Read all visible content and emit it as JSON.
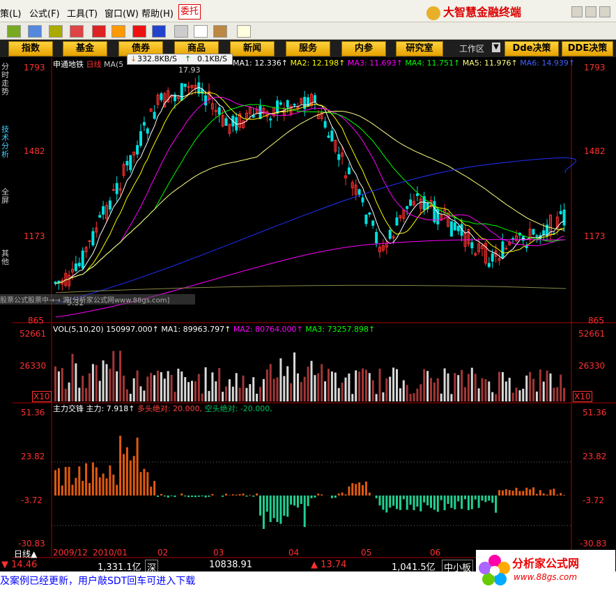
{
  "menu": {
    "items": [
      "策(L)",
      "公式(F)",
      "工具(T)",
      "窗口(W)",
      "帮助(H)"
    ],
    "entrust": "委托",
    "brand": "大智慧金融终端"
  },
  "nav": {
    "buttons": [
      "指数",
      "基金",
      "债券",
      "商品",
      "新闻",
      "服务",
      "内参",
      "研究室"
    ],
    "workspace": "工作区",
    "dde1": "Dde决策",
    "dde2": "DDE决策",
    "speed_down": "332.8KB/S",
    "speed_up": "0.1KB/S"
  },
  "sidebar": {
    "tabs": [
      "分时走势",
      "技术分析",
      "全屏",
      "其他"
    ]
  },
  "price_panel": {
    "title": "申通地铁",
    "period": "日线",
    "ma_prefix": "MA(5",
    "ma1": "MA1: 12.336↑",
    "ma2": "MA2: 12.198↑",
    "ma3": "MA3: 11.693↑",
    "ma4": "MA4: 11.751↑",
    "ma5": "MA5: 11.976↑",
    "ma6": "MA6: 14.939↑",
    "ylabels": [
      "1793",
      "1482",
      "1173",
      "865"
    ],
    "high_label": "17.93",
    "low_label": "9.32",
    "watermark": "股票公式股票中→→ 源[分析家公式网www.88gs.com]"
  },
  "vol_panel": {
    "title": "VOL(5,10,20)",
    "vol": "150997.000↑",
    "ma1": "MA1: 89963.797↑",
    "ma2": "MA2: 80764.000↑",
    "ma3": "MA3: 73257.898↑",
    "ylabels": [
      "52661",
      "26330",
      "X10"
    ]
  },
  "indicator_panel": {
    "title": "主力交锋",
    "main": "主力: 7.918↑",
    "bull": "多头绝对: 20.000,",
    "bear": "空头绝对: -20.000,",
    "ylabels": [
      "51.36",
      "23.82",
      "-3.72",
      "-30.83"
    ]
  },
  "dates": [
    "2009/12",
    "2010/01",
    "02",
    "03",
    "04",
    "05",
    "06"
  ],
  "status": {
    "day_button": "日线▲",
    "idx_change": "▼ 14.46",
    "amount": "1,331.1亿",
    "market": "深",
    "sz_index": "10838.91",
    "sz_change": "▲ 13.74",
    "sz_amount": "1,041.5亿",
    "board": "中小板"
  },
  "ticker": "及案例已经更新，用户敲SDT回车可进入下载",
  "logo": {
    "name": "分析家公式网",
    "url": "www.88gs.com"
  },
  "colors": {
    "up": "#ff3030",
    "down": "#00e0e0",
    "ma1": "#ffffff",
    "ma2": "#ffff00",
    "ma3": "#ff00ff",
    "ma4": "#00ff00",
    "ma5": "#ffff80",
    "ma6": "#2030ff"
  }
}
